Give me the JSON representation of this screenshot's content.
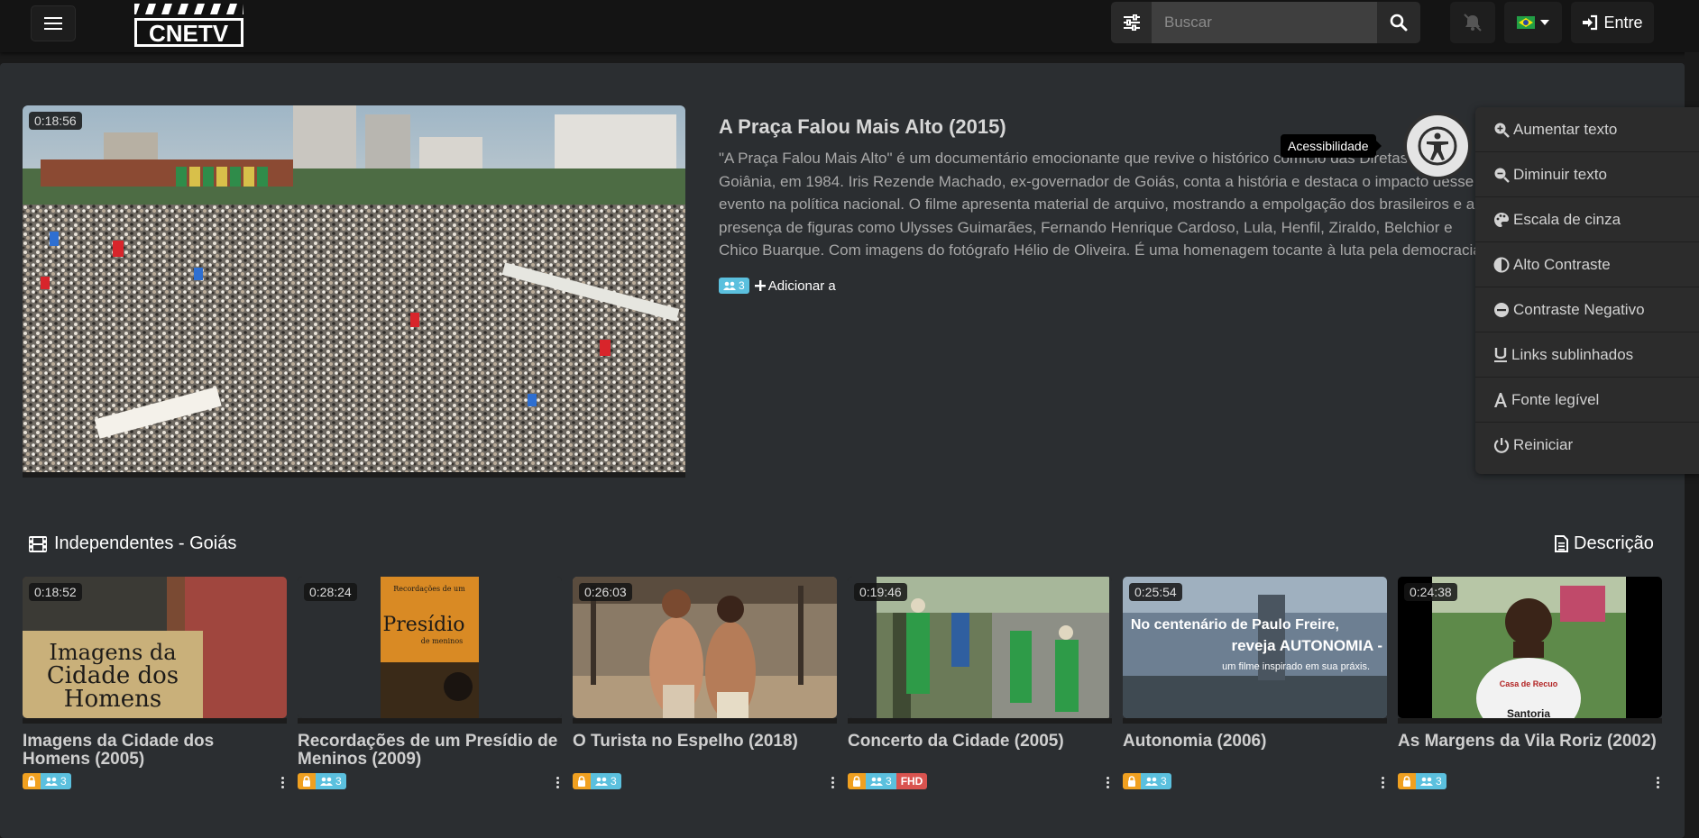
{
  "header": {
    "search_placeholder": "Buscar",
    "login_label": "Entre",
    "language": "Português (Brasil)"
  },
  "featured": {
    "duration": "0:18:56",
    "title": "A Praça Falou Mais Alto (2015)",
    "description": "\"A Praça Falou Mais Alto\" é um documentário emocionante que revive o histórico comício das Diretas Já em Goiânia, em 1984. Iris Rezende Machado, ex-governador de Goiás, conta a história e destaca o impacto desse evento na política nacional. O filme apresenta material de arquivo, mostrando a empolgação dos brasileiros e a presença de figuras como Ulysses Guimarães, Fernando Henrique Cardoso, Lula, Henfil, Ziraldo, Belchior e Chico Buarque. Com imagens do fotógrafo Hélio de Oliveira. É uma homenagem tocante à luta pela democracia, destacando o poder da união e determinação do povo.",
    "views": "3",
    "add_label": "Adicionar a"
  },
  "accessibility": {
    "tooltip": "Acessibilidade",
    "items": [
      {
        "label": "Aumentar texto"
      },
      {
        "label": "Diminuir texto"
      },
      {
        "label": "Escala de cinza"
      },
      {
        "label": "Alto Contraste"
      },
      {
        "label": "Contraste Negativo"
      },
      {
        "label": "Links sublinhados"
      },
      {
        "label": "Fonte legível"
      },
      {
        "label": "Reiniciar"
      }
    ]
  },
  "section": {
    "title": "Independentes - Goiás",
    "description_label": "Descrição"
  },
  "cards": [
    {
      "duration": "0:18:52",
      "title_line1": "Imagens da Cidade dos",
      "title_line2": "Homens (2005)",
      "views": "3"
    },
    {
      "duration": "0:28:24",
      "title_line1": "Recordações de um Presídio de",
      "title_line2": "Meninos (2009)",
      "views": "3"
    },
    {
      "duration": "0:26:03",
      "title_line1": "O Turista no Espelho (2018)",
      "title_line2": "",
      "views": "3"
    },
    {
      "duration": "0:19:46",
      "title_line1": "Concerto da Cidade (2005)",
      "title_line2": "",
      "views": "3",
      "quality": "FHD"
    },
    {
      "duration": "0:25:54",
      "title_line1": "Autonomia (2006)",
      "title_line2": "",
      "views": "3"
    },
    {
      "duration": "0:24:38",
      "title_line1": "As Margens da Vila Roriz (2002)",
      "title_line2": "",
      "views": "3"
    }
  ],
  "thumb_texts": {
    "card0_line1": "Imagens da",
    "card0_line2": "Cidade dos",
    "card0_line3": "Homens",
    "card1_line1": "Recordações de um",
    "card1_line2": "Presídio",
    "card1_line3": "de meninos",
    "card4_line1": "No centenário de Paulo Freire,",
    "card4_line2": "reveja AUTONOMIA -",
    "card4_line3": "um filme inspirado em sua práxis.",
    "card5_shirt1": "Casa de Recuo",
    "card5_shirt2": "Santoria"
  },
  "colors": {
    "views_badge": "#5bc0de",
    "lock_badge": "#f0a020",
    "fhd_badge": "#d9534f",
    "panel_bg": "#2b2e31",
    "topbar_bg": "#141414"
  }
}
